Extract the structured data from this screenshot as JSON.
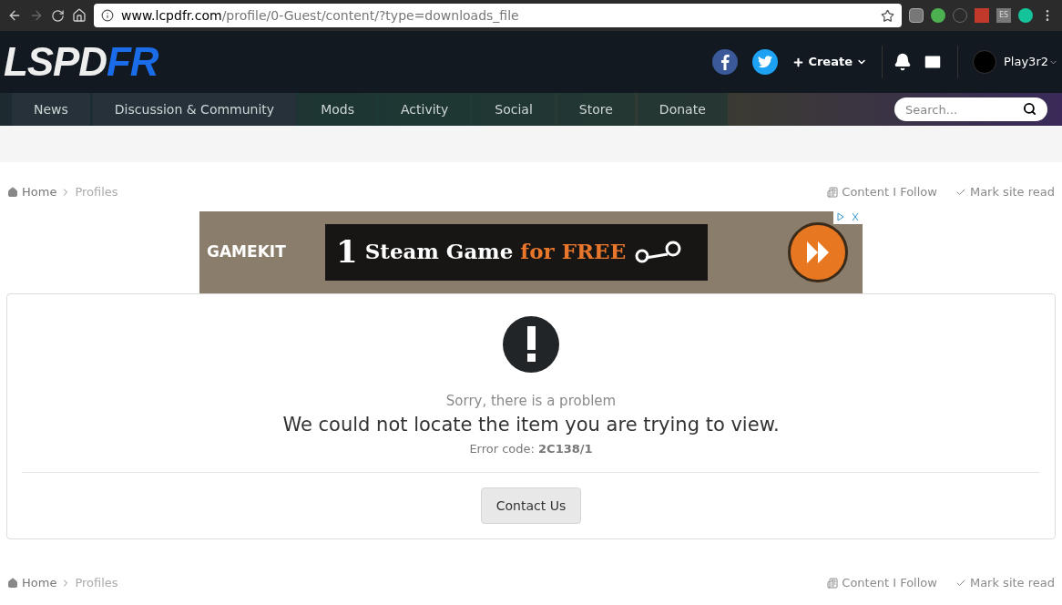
{
  "browser": {
    "url_host": "www.lcpdfr.com",
    "url_path": "/profile/0-Guest/content/?type=downloads_file",
    "extension_label": "ES"
  },
  "header": {
    "logo": {
      "part_1": "LSPD",
      "part_2": "FR"
    },
    "create": "Create",
    "user": "Play3r2"
  },
  "nav": {
    "items": [
      "News",
      "Discussion & Community",
      "Mods",
      "Activity",
      "Social",
      "Store",
      "Donate"
    ],
    "search": {
      "placeholder": "Search..."
    }
  },
  "breadcrumb_top": {
    "items": [
      "Home",
      "Profiles"
    ],
    "actions": [
      "Content I Follow",
      "Mark site read"
    ]
  },
  "ad": {
    "brand": "GAMEKIT",
    "number": "1",
    "headline": "Steam Game",
    "highlight": "for FREE"
  },
  "error": {
    "subtitle": "Sorry, there is a problem",
    "title": "We could not locate the item you are trying to view.",
    "code": "Error code: **2C138/1**",
    "button": "Contact Us"
  },
  "breadcrumb_bottom": {
    "items": [
      "Home",
      "Profiles"
    ],
    "actions": [
      "Content I Follow",
      "Mark site read"
    ]
  }
}
